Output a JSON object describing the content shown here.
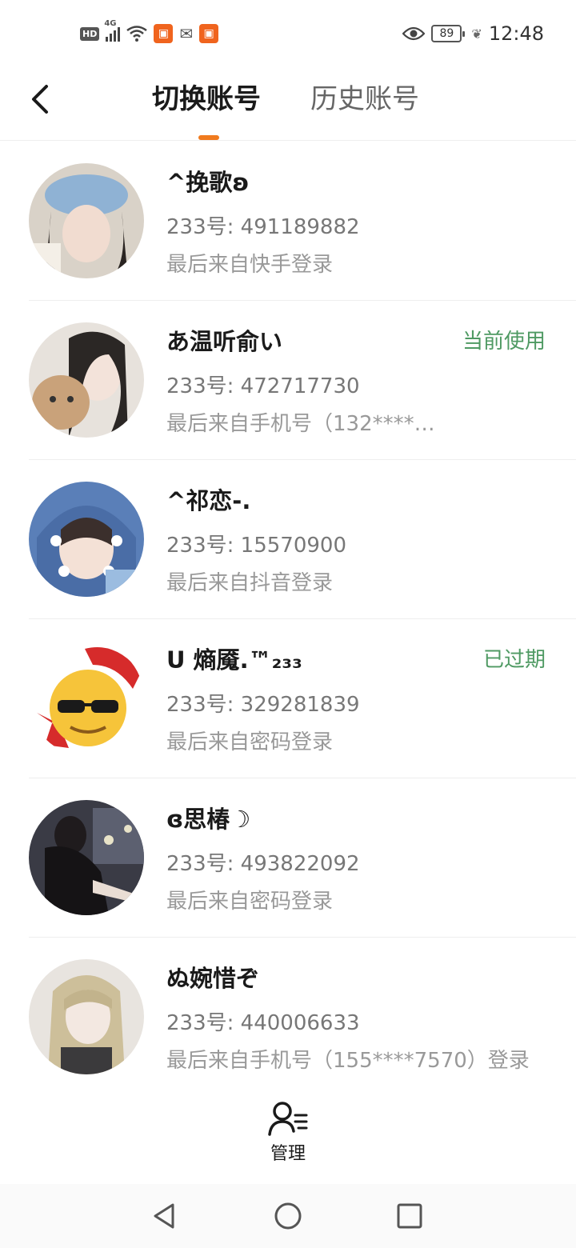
{
  "status_bar": {
    "hd": "HD",
    "network": "4G",
    "battery": "89",
    "time": "12:48",
    "icons": [
      "hd-icon",
      "signal-icon",
      "wifi-icon",
      "kuaishou-icon",
      "wechat-icon",
      "kuaishou-icon",
      "eye-icon",
      "battery-icon",
      "leaf-icon"
    ]
  },
  "header": {
    "tab_active": "切换账号",
    "tab_inactive": "历史账号",
    "accent_color": "#f07a1e"
  },
  "accounts": [
    {
      "name": "^挽歌ʚ",
      "id": "233号: 491189882",
      "login": "最后来自快手登录",
      "badge": ""
    },
    {
      "name": "あ温听俞い",
      "id": "233号: 472717730",
      "login": "最后来自手机号（132****…",
      "badge": "当前使用"
    },
    {
      "name": "^祁恋-.",
      "id": "233号: 15570900",
      "login": "最后来自抖音登录",
      "badge": ""
    },
    {
      "name": "ᑌ 熵魇.™₂₃₃",
      "id": "233号: 329281839",
      "login": "最后来自密码登录",
      "badge": "已过期"
    },
    {
      "name": "ɞ思椿☽",
      "id": "233号: 493822092",
      "login": "最后来自密码登录",
      "badge": ""
    },
    {
      "name": "ぬ婉惜ぞ",
      "id": "233号: 440006633",
      "login": "最后来自手机号（155****7570）登录",
      "badge": ""
    }
  ],
  "badge_color": "#4f9a63",
  "manage": {
    "label": "管理"
  }
}
